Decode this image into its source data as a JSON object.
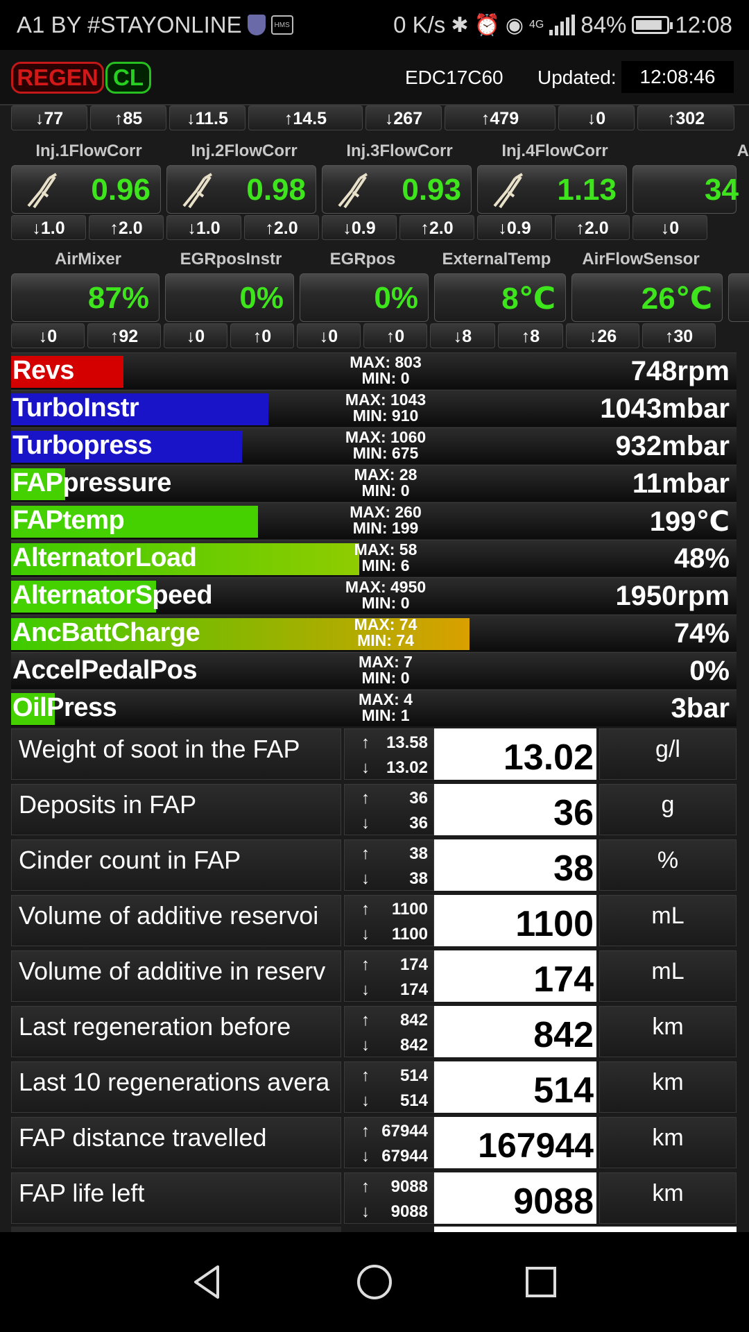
{
  "status_bar": {
    "carrier": "A1 BY #STAYONLINE",
    "speed": "0 K/s",
    "network": "4G",
    "battery": "84%",
    "time": "12:08",
    "icons": [
      "shield-icon",
      "hms-icon",
      "bluetooth-icon",
      "alarm-icon",
      "eye-icon",
      "signal-icon",
      "battery-icon"
    ]
  },
  "header": {
    "regen_label": "REGEN",
    "cl_label": "CL",
    "ecu": "EDC17C60",
    "updated_label": "Updated:",
    "updated_time": "12:08:46"
  },
  "minmax_top": [
    "↓77",
    "↑85",
    "↓11.5",
    "↑14.5",
    "↓267",
    "↑479",
    "↓0",
    "↑302"
  ],
  "injector_labels": [
    "Inj.1FlowCorr",
    "Inj.2FlowCorr",
    "Inj.3FlowCorr",
    "Inj.4FlowCorr",
    "A"
  ],
  "injector_values": [
    "0.96",
    "0.98",
    "0.93",
    "1.13",
    "34"
  ],
  "injector_minmax": [
    "↓1.0",
    "↑2.0",
    "↓1.0",
    "↑2.0",
    "↓0.9",
    "↑2.0",
    "↓0.9",
    "↑2.0",
    "↓0"
  ],
  "sensor_labels": [
    "AirMixer",
    "EGRposInstr",
    "EGRpos",
    "ExternalTemp",
    "AirFlowSensor"
  ],
  "sensor_values": [
    "87%",
    "0%",
    "0%",
    "8℃",
    "26℃"
  ],
  "sensor_minmax": [
    "↓0",
    "↑92",
    "↓0",
    "↑0",
    "↓0",
    "↑0",
    "↓8",
    "↑8",
    "↓26",
    "↑30"
  ],
  "bars": [
    {
      "name": "Revs",
      "max": "MAX: 803",
      "min": "MIN: 0",
      "value": "748rpm",
      "fill": 0.155,
      "color": "#d40000"
    },
    {
      "name": "TurboInstr",
      "max": "MAX: 1043",
      "min": "MIN: 910",
      "value": "1043mbar",
      "fill": 0.355,
      "color": "#1a14c8"
    },
    {
      "name": "Turbopress",
      "max": "MAX: 1060",
      "min": "MIN: 675",
      "value": "932mbar",
      "fill": 0.318,
      "color": "#1a14c8"
    },
    {
      "name": "FAPpressure",
      "max": "MAX: 28",
      "min": "MIN: 0",
      "value": "11mbar",
      "fill": 0.075,
      "color": "#45d100"
    },
    {
      "name": "FAPtemp",
      "max": "MAX: 260",
      "min": "MIN: 199",
      "value": "199℃",
      "fill": 0.34,
      "color": "#45d100"
    },
    {
      "name": "AlternatorLoad",
      "max": "MAX: 58",
      "min": "MIN: 6",
      "value": "48%",
      "fill": 0.48,
      "color": "#8fcc00"
    },
    {
      "name": "AlternatorSpeed",
      "max": "MAX: 4950",
      "min": "MIN: 0",
      "value": "1950rpm",
      "fill": 0.2,
      "color": "#45d100"
    },
    {
      "name": "AncBattCharge",
      "max": "MAX: 74",
      "min": "MIN: 74",
      "value": "74%",
      "fill": 0.632,
      "color": "#d9a000"
    },
    {
      "name": "AccelPedalPos",
      "max": "MAX: 7",
      "min": "MIN: 0",
      "value": "0%",
      "fill": 0.0,
      "color": "#45d100"
    },
    {
      "name": "OilPress",
      "max": "MAX: 4",
      "min": "MIN: 1",
      "value": "3bar",
      "fill": 0.06,
      "color": "#45d100"
    }
  ],
  "table": [
    {
      "name": "Weight of soot in the FAP",
      "up": "13.58",
      "down": "13.02",
      "value": "13.02",
      "unit": "g/l"
    },
    {
      "name": "Deposits in FAP",
      "up": "36",
      "down": "36",
      "value": "36",
      "unit": "g"
    },
    {
      "name": "Cinder count in FAP",
      "up": "38",
      "down": "38",
      "value": "38",
      "unit": "%"
    },
    {
      "name": "Volume of additive reservoi",
      "up": "1100",
      "down": "1100",
      "value": "1100",
      "unit": "mL"
    },
    {
      "name": "Volume of additive in reserv",
      "up": "174",
      "down": "174",
      "value": "174",
      "unit": "mL"
    },
    {
      "name": "Last regeneration before",
      "up": "842",
      "down": "842",
      "value": "842",
      "unit": "km"
    },
    {
      "name": "Last 10 regenerations avera",
      "up": "514",
      "down": "514",
      "value": "514",
      "unit": "km"
    },
    {
      "name": "FAP distance travelled",
      "up": "67944",
      "down": "67944",
      "value": "167944",
      "unit": "km"
    },
    {
      "name": "FAP life left",
      "up": "9088",
      "down": "9088",
      "value": "9088",
      "unit": "km"
    }
  ],
  "nav": {
    "back": "back-icon",
    "home": "home-icon",
    "recents": "recents-icon"
  }
}
